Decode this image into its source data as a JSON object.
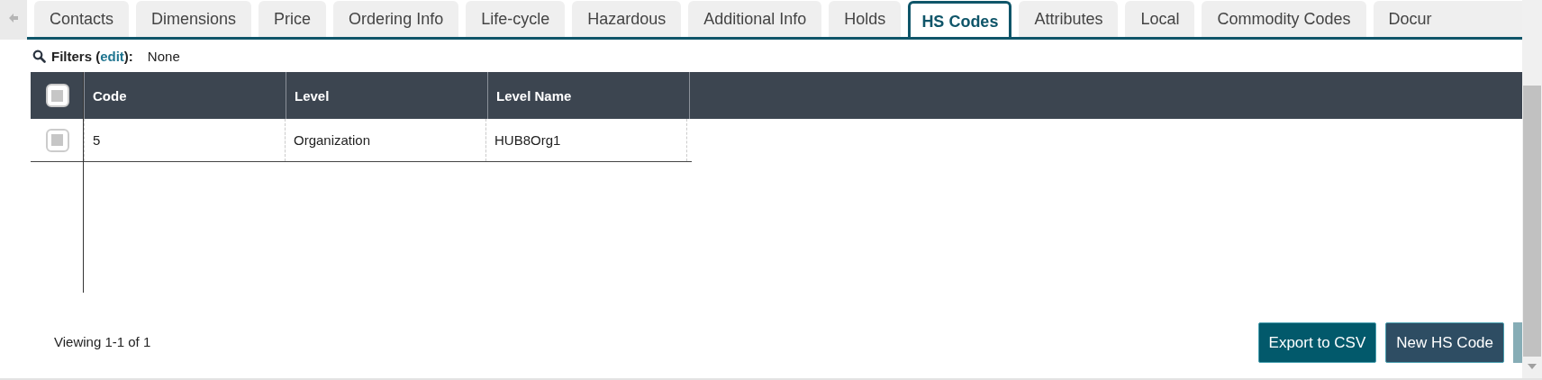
{
  "tabs": [
    {
      "label": "Contacts",
      "selected": false
    },
    {
      "label": "Dimensions",
      "selected": false
    },
    {
      "label": "Price",
      "selected": false
    },
    {
      "label": "Ordering Info",
      "selected": false
    },
    {
      "label": "Life-cycle",
      "selected": false
    },
    {
      "label": "Hazardous",
      "selected": false
    },
    {
      "label": "Additional Info",
      "selected": false
    },
    {
      "label": "Holds",
      "selected": false
    },
    {
      "label": "HS Codes",
      "selected": true
    },
    {
      "label": "Attributes",
      "selected": false
    },
    {
      "label": "Local",
      "selected": false
    },
    {
      "label": "Commodity Codes",
      "selected": false
    },
    {
      "label": "Docur",
      "selected": false
    }
  ],
  "filters": {
    "label": "Filters (",
    "link": "edit",
    "after": "):",
    "value": "None"
  },
  "table": {
    "select_all_checked": false,
    "columns": [
      "Code",
      "Level",
      "Level Name"
    ],
    "rows": [
      {
        "checked": false,
        "cells": [
          "5",
          "Organization",
          "HUB8Org1"
        ]
      }
    ]
  },
  "footer": {
    "viewing": "Viewing 1-1 of 1"
  },
  "buttons": [
    {
      "label": "Export to CSV",
      "kind": "export"
    },
    {
      "label": "New HS Code",
      "kind": "new"
    }
  ]
}
